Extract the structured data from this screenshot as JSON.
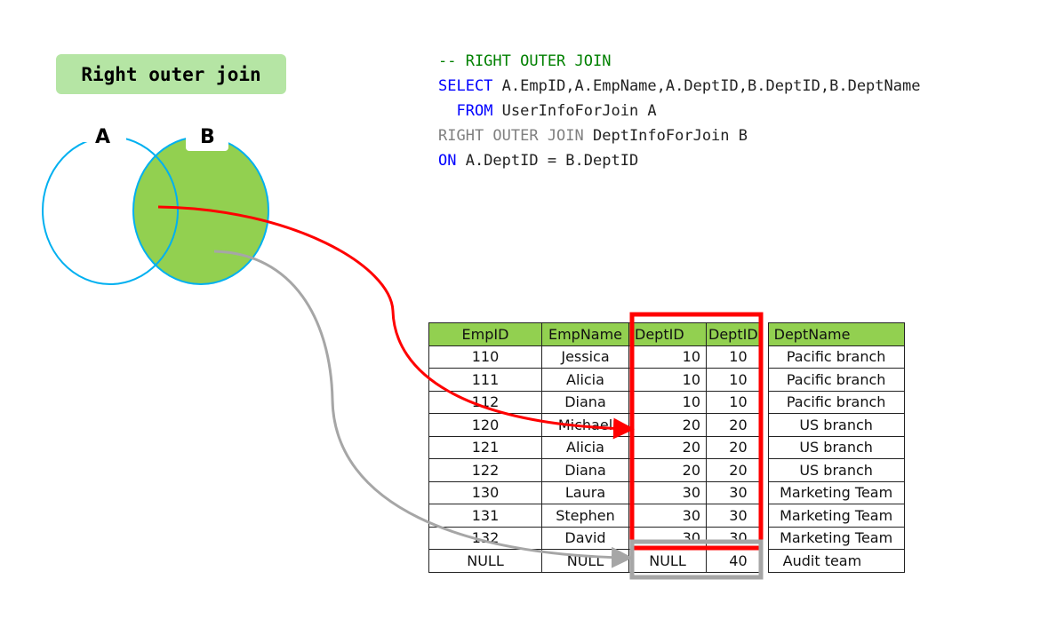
{
  "title": "Right outer join",
  "venn": {
    "left_label": "A",
    "right_label": "B",
    "fill": "#92d050",
    "stroke": "#00b0f0"
  },
  "sql": {
    "comment": "-- RIGHT OUTER JOIN",
    "select_kw": "SELECT",
    "select_cols": " A.EmpID,A.EmpName,A.DeptID,B.DeptID,B.DeptName",
    "from_kw": "FROM",
    "from_tbl": " UserInfoForJoin A",
    "join_kw": "RIGHT OUTER JOIN",
    "join_tbl": " DeptInfoForJoin B",
    "on_kw": "ON",
    "on_cond": " A.DeptID = B.DeptID"
  },
  "table": {
    "headers": [
      "EmpID",
      "EmpName",
      "DeptID",
      "DeptID",
      "DeptName"
    ],
    "rows": [
      [
        "110",
        "Jessica",
        "10",
        "10",
        "Pacific branch"
      ],
      [
        "111",
        "Alicia",
        "10",
        "10",
        "Pacific branch"
      ],
      [
        "112",
        "Diana",
        "10",
        "10",
        "Pacific branch"
      ],
      [
        "120",
        "Michael",
        "20",
        "20",
        "US branch"
      ],
      [
        "121",
        "Alicia",
        "20",
        "20",
        "US branch"
      ],
      [
        "122",
        "Diana",
        "20",
        "20",
        "US branch"
      ],
      [
        "130",
        "Laura",
        "30",
        "30",
        "Marketing Team"
      ],
      [
        "131",
        "Stephen",
        "30",
        "30",
        "Marketing Team"
      ],
      [
        "132",
        "David",
        "30",
        "30",
        "Marketing Team"
      ],
      [
        "NULL",
        "NULL",
        "NULL",
        "40",
        "Audit team"
      ]
    ]
  },
  "colors": {
    "match_box": "#ff0000",
    "null_box": "#a6a6a6",
    "header": "#92d050"
  }
}
